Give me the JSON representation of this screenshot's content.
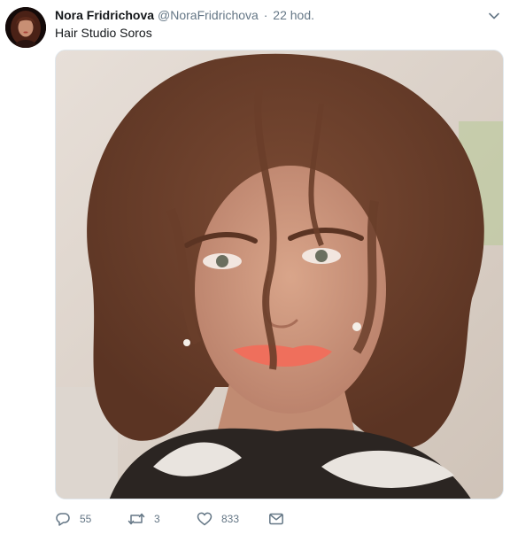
{
  "tweet": {
    "author_name": "Nora Fridrichova",
    "handle": "@NoraFridrichova",
    "separator": "·",
    "timestamp": "22 hod.",
    "text": "Hair Studio Soros"
  },
  "icons": {
    "avatar": "profile-photo",
    "caret": "chevron-down-icon",
    "reply": "reply-icon",
    "retweet": "retweet-icon",
    "like": "heart-icon",
    "dm": "envelope-icon"
  },
  "actions": {
    "replies": "55",
    "retweets": "3",
    "likes": "833"
  },
  "colors": {
    "text": "#14171a",
    "secondary": "#657786",
    "border": "#e1e8ed"
  }
}
